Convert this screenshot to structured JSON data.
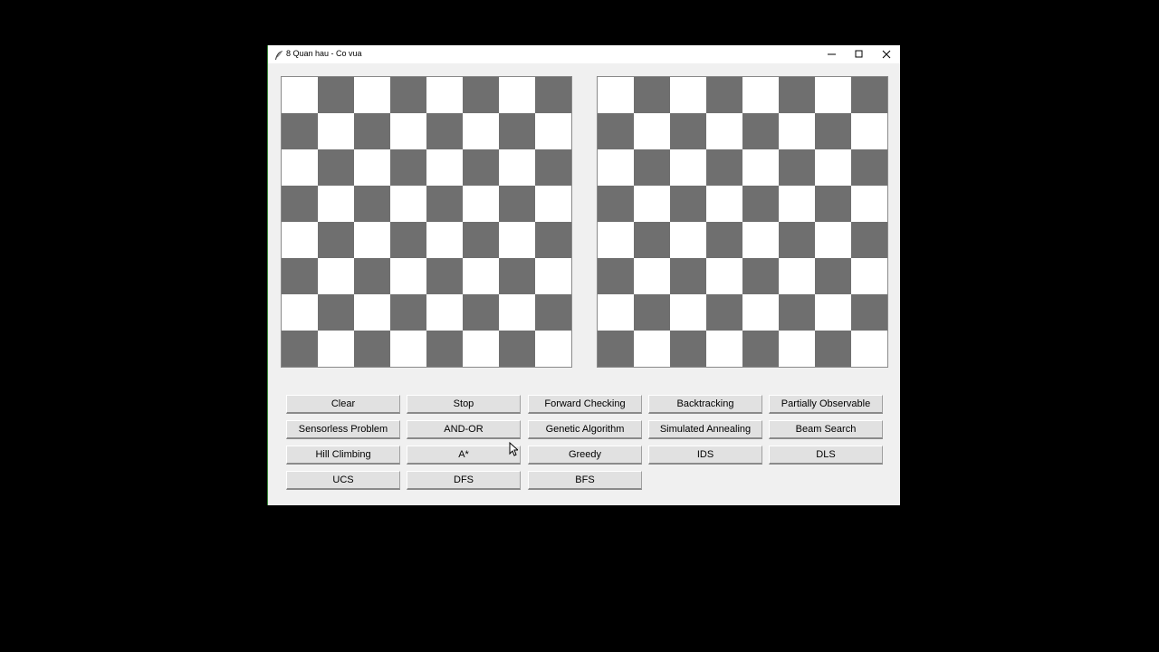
{
  "window": {
    "title": "8 Quan hau - Co vua",
    "icon": "feather-icon",
    "controls": [
      "minimize-icon",
      "maximize-icon",
      "close-icon"
    ]
  },
  "boards": {
    "size": 8,
    "light_color": "#ffffff",
    "dark_color": "#6f6f6f"
  },
  "buttons": {
    "row1": [
      "Clear",
      "Stop",
      "Forward Checking",
      "Backtracking",
      "Partially Observable"
    ],
    "row2": [
      "Sensorless Problem",
      "AND-OR",
      "Genetic Algorithm",
      "Simulated Annealing",
      "Beam Search"
    ],
    "row3": [
      "Hill Climbing",
      "A*",
      "Greedy",
      "IDS",
      "DLS"
    ],
    "row4": [
      "UCS",
      "DFS",
      "BFS"
    ]
  }
}
